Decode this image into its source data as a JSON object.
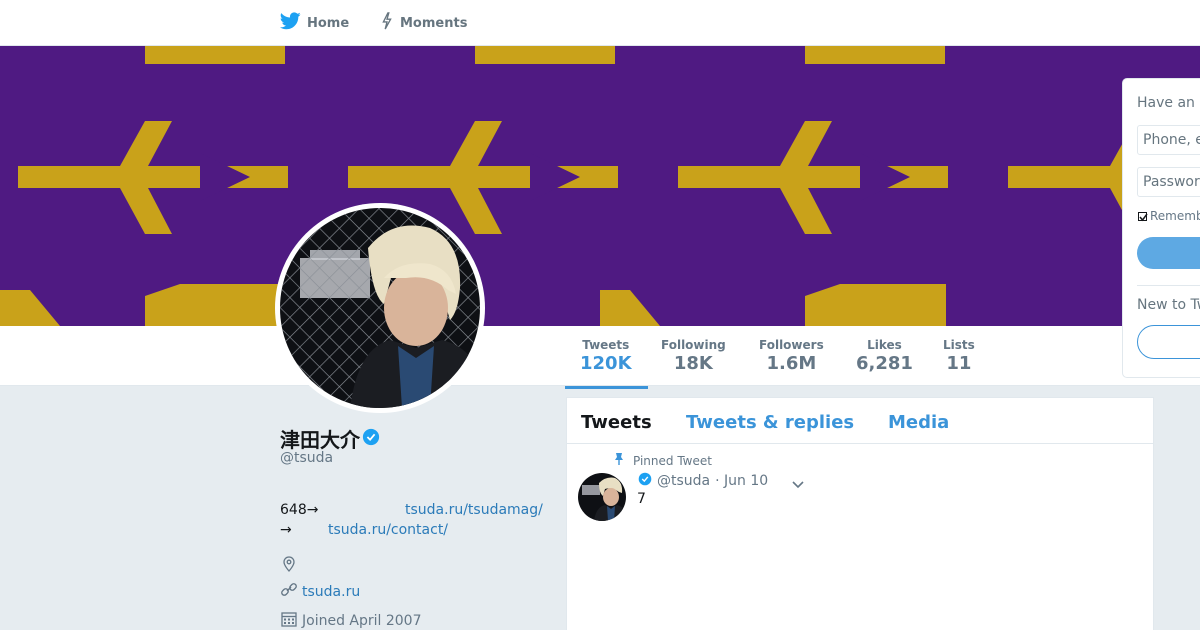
{
  "nav": {
    "home": "Home",
    "moments": "Moments"
  },
  "stats": {
    "tweets": {
      "label": "Tweets",
      "value": "120K"
    },
    "following": {
      "label": "Following",
      "value": "18K"
    },
    "followers": {
      "label": "Followers",
      "value": "1.6M"
    },
    "likes": {
      "label": "Likes",
      "value": "6,281"
    },
    "lists": {
      "label": "Lists",
      "value": "11"
    }
  },
  "profile": {
    "name": "津田大介",
    "handle": "@tsuda",
    "bio_line1_text": "648→",
    "bio_line1_link": "tsuda.ru/tsudamag/",
    "bio_line2_text": "→",
    "bio_line2_link": "tsuda.ru/contact/",
    "url": "tsuda.ru",
    "joined": "Joined April 2007"
  },
  "timeline": {
    "tabs": [
      "Tweets",
      "Tweets & replies",
      "Media"
    ],
    "pinned_label": "Pinned Tweet",
    "tweet": {
      "handle": "@tsuda",
      "date": "· Jun 10",
      "text": "7"
    }
  },
  "login": {
    "title": "Have an account?",
    "phone_placeholder": "Phone, email, or username",
    "password_placeholder": "Password",
    "remember": "Remember me",
    "new_to": "New to Twitter?"
  },
  "colors": {
    "accent": "#3b94d9",
    "banner_purple": "#4f1a82",
    "banner_gold": "#c9a21a",
    "link": "#2b7bb9"
  }
}
